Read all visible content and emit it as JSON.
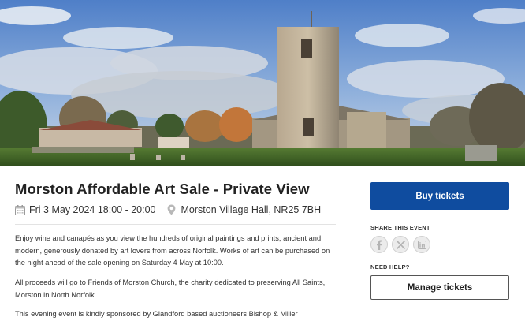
{
  "event": {
    "title": "Morston Affordable Art Sale - Private View",
    "date": "Fri 3 May 2024 18:00 - 20:00",
    "venue": "Morston Village Hall, NR25 7BH",
    "description": [
      "Enjoy wine and canapés as you view the hundreds of original paintings and prints, ancient and modern, generously donated by art lovers from across Norfolk. Works of art can be purchased on the night ahead of the sale opening on Saturday 4 May at 10:00.",
      "All proceeds will go to Friends of Morston Church, the charity dedicated to preserving All Saints, Morston in North Norfolk.",
      "This evening event is kindly sponsored by Glandford based auctioneers Bishop & Miller"
    ]
  },
  "actions": {
    "buy_label": "Buy tickets",
    "share_label": "SHARE THIS EVENT",
    "help_label": "NEED HELP?",
    "manage_label": "Manage tickets"
  },
  "share_icons": [
    "facebook-icon",
    "x-icon",
    "linkedin-icon"
  ],
  "icons": {
    "date": "calendar-icon",
    "venue": "location-pin-icon"
  },
  "colors": {
    "primary": "#0f4c9f",
    "text": "#222222",
    "share_icon_bg": "#ececec"
  }
}
